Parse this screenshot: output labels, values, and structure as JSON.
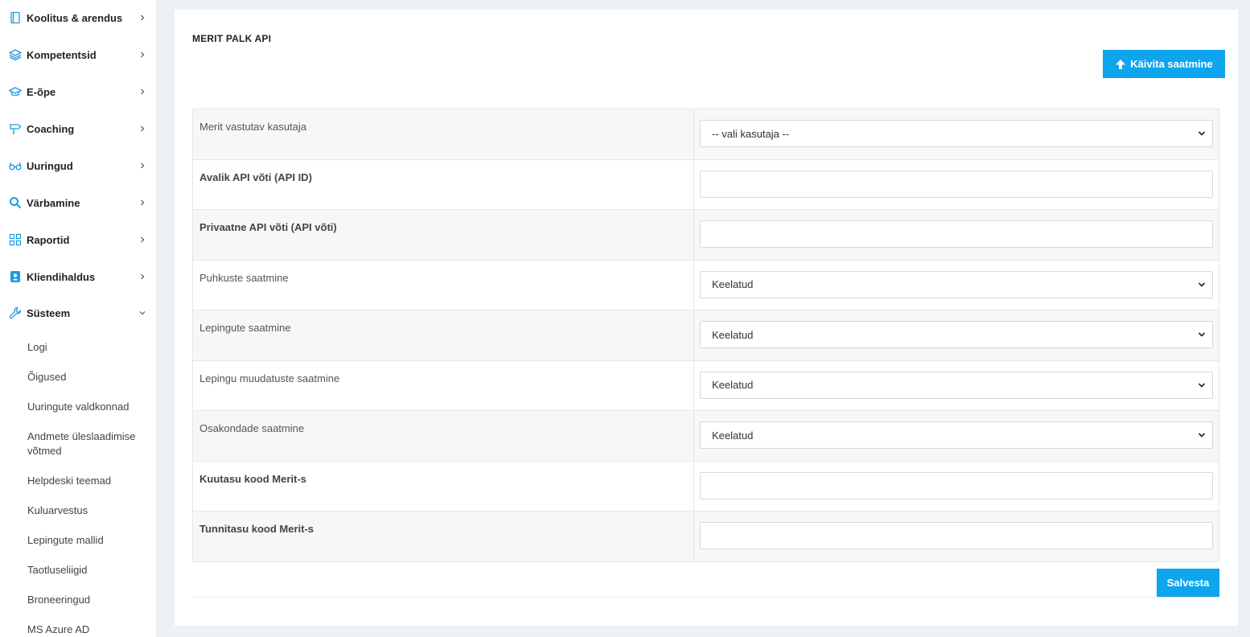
{
  "sidebar": {
    "items": [
      {
        "label": "Koolitus & arendus",
        "icon": "notebook-icon",
        "expanded": false
      },
      {
        "label": "Kompetentsid",
        "icon": "layers-icon",
        "expanded": false
      },
      {
        "label": "E-õpe",
        "icon": "graduation-cap-icon",
        "expanded": false
      },
      {
        "label": "Coaching",
        "icon": "signpost-icon",
        "expanded": false
      },
      {
        "label": "Uuringud",
        "icon": "glasses-icon",
        "expanded": false
      },
      {
        "label": "Värbamine",
        "icon": "search-icon",
        "expanded": false
      },
      {
        "label": "Raportid",
        "icon": "grid-icon",
        "expanded": false
      },
      {
        "label": "Kliendihaldus",
        "icon": "contact-card-icon",
        "expanded": false
      },
      {
        "label": "Süsteem",
        "icon": "wrench-icon",
        "expanded": true
      }
    ],
    "subitems": [
      {
        "label": "Logi"
      },
      {
        "label": "Õigused"
      },
      {
        "label": "Uuringute valdkonnad"
      },
      {
        "label": "Andmete üleslaadimise võtmed"
      },
      {
        "label": "Helpdeski teemad"
      },
      {
        "label": "Kuluarvestus"
      },
      {
        "label": "Lepingute mallid"
      },
      {
        "label": "Taotluseliigid"
      },
      {
        "label": "Broneeringud"
      },
      {
        "label": "MS Azure AD"
      }
    ]
  },
  "main": {
    "title": "MERIT PALK API",
    "run_button_label": "Käivita saatmine",
    "save_button_label": "Salvesta",
    "fields": [
      {
        "label": "Merit vastutav kasutaja",
        "type": "select",
        "value": "-- vali kasutaja --"
      },
      {
        "label": "Avalik API võti (API ID)",
        "type": "text",
        "value": ""
      },
      {
        "label": "Privaatne API võti (API võti)",
        "type": "text",
        "value": ""
      },
      {
        "label": "Puhkuste saatmine",
        "type": "select",
        "value": "Keelatud"
      },
      {
        "label": "Lepingute saatmine",
        "type": "select",
        "value": "Keelatud"
      },
      {
        "label": "Lepingu muudatuste saatmine",
        "type": "select",
        "value": "Keelatud"
      },
      {
        "label": "Osakondade saatmine",
        "type": "select",
        "value": "Keelatud"
      },
      {
        "label": "Kuutasu kood Merit-s",
        "type": "text",
        "value": ""
      },
      {
        "label": "Tunnitasu kood Merit-s",
        "type": "text",
        "value": ""
      }
    ]
  },
  "colors": {
    "accent": "#0ea5ef",
    "icon_blue": "#1a9be0",
    "page_bg": "#eef1f4"
  }
}
